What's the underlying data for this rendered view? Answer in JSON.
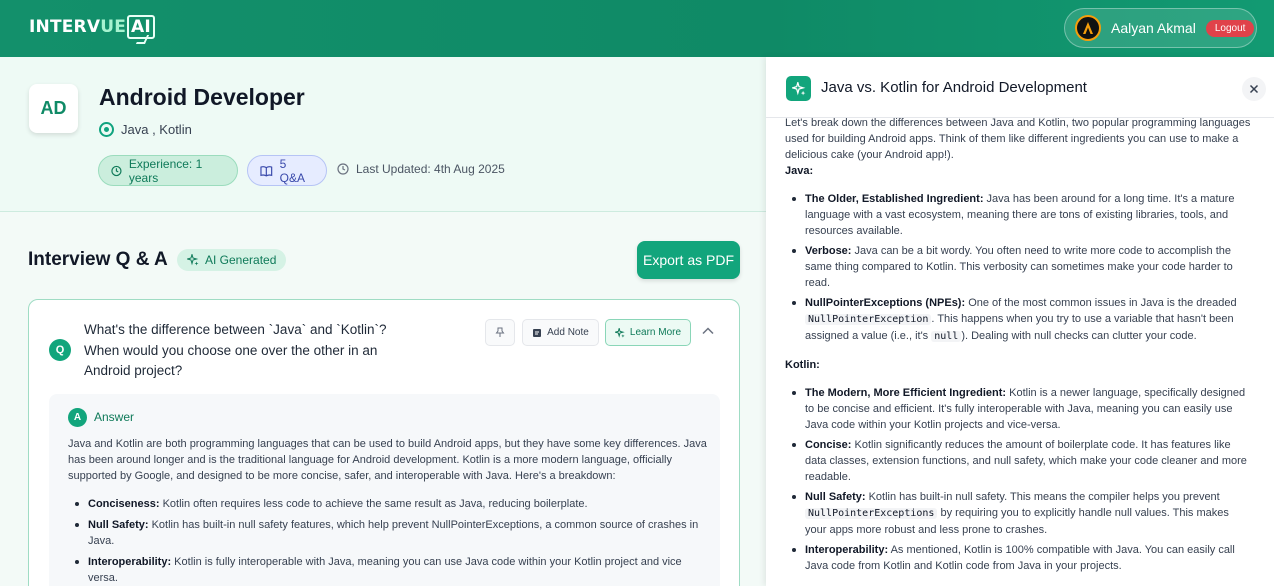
{
  "header": {
    "logo_main": "INTERV",
    "logo_accent": "UE",
    "logo_bubble": "AI",
    "user_name": "Aalyan Akmal",
    "logout_label": "Logout"
  },
  "profile": {
    "initials": "AD",
    "title": "Android Developer",
    "skills": "Java , Kotlin",
    "experience": "Experience: 1 years",
    "qa_count": "5 Q&A",
    "last_updated": "Last Updated: 4th Aug 2025"
  },
  "qa_section": {
    "heading": "Interview Q & A",
    "ai_badge": "AI Generated",
    "export_label": "Export as PDF"
  },
  "question": {
    "badge": "Q",
    "text": "What's the difference between `Java` and `Kotlin`? When would you choose one over the other in an Android project?",
    "add_note_label": "Add Note",
    "learn_more_label": "Learn More",
    "answer_badge": "A",
    "answer_label": "Answer",
    "answer_intro": "Java and Kotlin are both programming languages that can be used to build Android apps, but they have some key differences. Java has been around longer and is the traditional language for Android development. Kotlin is a more modern language, officially supported by Google, and designed to be more concise, safer, and interoperable with Java. Here's a breakdown:",
    "points": [
      {
        "term": "Conciseness:",
        "text": " Kotlin often requires less code to achieve the same result as Java, reducing boilerplate."
      },
      {
        "term": "Null Safety:",
        "text": " Kotlin has built-in null safety features, which help prevent NullPointerExceptions, a common source of crashes in Java."
      },
      {
        "term": "Interoperability:",
        "text": " Kotlin is fully interoperable with Java, meaning you can use Java code within your Kotlin project and vice versa."
      }
    ]
  },
  "panel": {
    "title": "Java vs. Kotlin for Android Development",
    "intro": "Let's break down the differences between Java and Kotlin, two popular programming languages used for building Android apps. Think of them like different ingredients you can use to make a delicious cake (your Android app!).",
    "java_heading": "Java:",
    "java_points": [
      {
        "term": "The Older, Established Ingredient:",
        "text": " Java has been around for a long time. It's a mature language with a vast ecosystem, meaning there are tons of existing libraries, tools, and resources available."
      },
      {
        "term": "Verbose:",
        "text": " Java can be a bit wordy. You often need to write more code to accomplish the same thing compared to Kotlin. This verbosity can sometimes make your code harder to read."
      }
    ],
    "npe": {
      "term": "NullPointerExceptions (NPEs):",
      "text1": " One of the most common issues in Java is the dreaded ",
      "code1": "NullPointerException",
      "text2": ". This happens when you try to use a variable that hasn't been assigned a value (i.e., it's ",
      "code2": "null",
      "text3": "). Dealing with null checks can clutter your code."
    },
    "kotlin_heading": "Kotlin:",
    "kotlin_points": [
      {
        "term": "The Modern, More Efficient Ingredient:",
        "text": " Kotlin is a newer language, specifically designed to be concise and efficient. It's fully interoperable with Java, meaning you can easily use Java code within your Kotlin projects and vice-versa."
      },
      {
        "term": "Concise:",
        "text": " Kotlin significantly reduces the amount of boilerplate code. It has features like data classes, extension functions, and null safety, which make your code cleaner and more readable."
      }
    ],
    "nullsafety": {
      "term": "Null Safety:",
      "text1": " Kotlin has built-in null safety. This means the compiler helps you prevent ",
      "code1": "NullPointerExceptions",
      "text2": " by requiring you to explicitly handle null values. This makes your apps more robust and less prone to crashes."
    },
    "interop": {
      "term": "Interoperability:",
      "text": " As mentioned, Kotlin is 100% compatible with Java. You can easily call Java code from Kotlin and Kotlin code from Java in your projects."
    }
  },
  "icons": [
    "logo",
    "avatar-icon",
    "target-icon",
    "clock-icon",
    "book-icon",
    "sparkle-icon",
    "pin-icon",
    "note-icon",
    "chevron-up-icon",
    "close-icon"
  ],
  "colors": {
    "brand": "#12a57c",
    "logout": "#e0424a",
    "header": "#0f8a66"
  }
}
